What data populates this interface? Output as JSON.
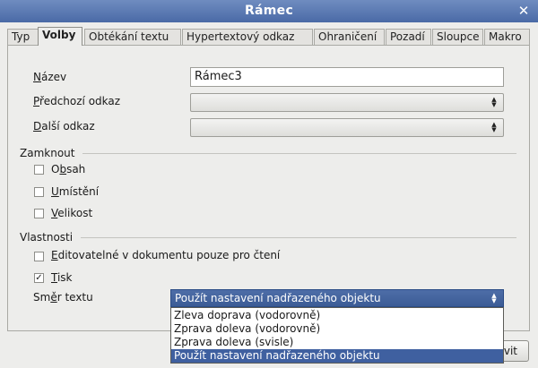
{
  "window": {
    "title": "Rámec",
    "close_glyph": "✕"
  },
  "tabs": [
    {
      "label": "Typ"
    },
    {
      "label": "Volby"
    },
    {
      "label": "Obtékání textu"
    },
    {
      "label": "Hypertextový odkaz"
    },
    {
      "label": "Ohraničení"
    },
    {
      "label": "Pozadí"
    },
    {
      "label": "Sloupce"
    },
    {
      "label": "Makro"
    }
  ],
  "fields": {
    "name": {
      "label_first": "N",
      "label_rest": "ázev",
      "value": "Rámec3"
    },
    "prev_link": {
      "label_first": "P",
      "label_rest": "ředchozí odkaz",
      "value": ""
    },
    "next_link": {
      "label_first": "D",
      "label_rest": "alší odkaz",
      "value": ""
    }
  },
  "lock": {
    "heading": "Zamknout",
    "items": [
      {
        "pre": "O",
        "u": "b",
        "post": "sah",
        "checked": false
      },
      {
        "pre": "",
        "u": "U",
        "post": "místění",
        "checked": false
      },
      {
        "pre": "",
        "u": "V",
        "post": "elikost",
        "checked": false
      }
    ]
  },
  "props": {
    "heading": "Vlastnosti",
    "editable": {
      "u": "E",
      "post": "ditovatelné v dokumentu pouze pro čtení",
      "checked": false
    },
    "print": {
      "u": "T",
      "post": "isk",
      "checked": true
    },
    "direction_label": {
      "pre": "Sm",
      "u": "ě",
      "post": "r textu"
    },
    "direction_value": "Použít nastavení nadřazeného objektu",
    "direction_options": [
      "Zleva doprava (vodorovně)",
      "Zprava doleva (vodorovně)",
      "Zprava doleva (svisle)",
      "Použít nastavení nadřazeného objektu"
    ]
  },
  "buttons": {
    "partial_label": "vit"
  },
  "glyphs": {
    "check": "✓",
    "spin": "▲▼"
  }
}
